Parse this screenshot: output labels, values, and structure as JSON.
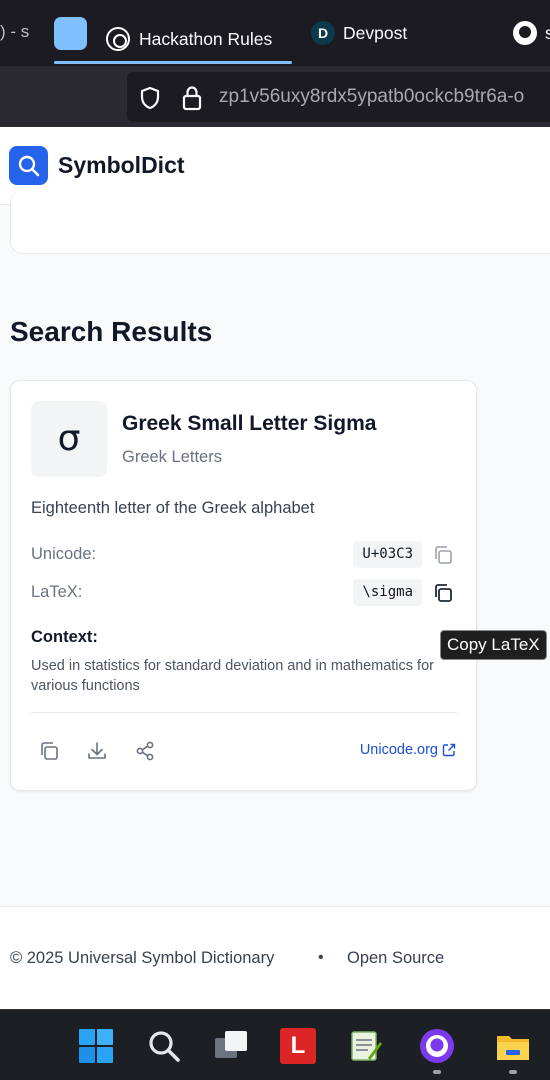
{
  "browser": {
    "tab_fragment": ") - s",
    "tabs": [
      {
        "label": "Hackathon Rules",
        "icon": "openai-icon",
        "active": true
      },
      {
        "label": "Devpost",
        "icon": "devpost-icon",
        "icon_letter": "D"
      },
      {
        "label": "s",
        "icon": "github-icon"
      }
    ],
    "url": "zp1v56uxy8rdx5ypatb0ockcb9tr6a-o"
  },
  "app": {
    "title": "SymbolDict",
    "accent": "#2563eb"
  },
  "results": {
    "heading": "Search Results",
    "card": {
      "glyph": "σ",
      "name": "Greek Small Letter Sigma",
      "category": "Greek Letters",
      "description": "Eighteenth letter of the Greek alphabet",
      "unicode_label": "Unicode:",
      "unicode_value": "U+03C3",
      "latex_label": "LaTeX:",
      "latex_value": "\\sigma",
      "context_label": "Context:",
      "context_text": "Used in statistics for standard deviation and in mathematics for various functions",
      "external_link": "Unicode.org"
    }
  },
  "tooltip": "Copy LaTeX",
  "footer": {
    "copyright": "© 2025 Universal Symbol Dictionary",
    "separator": "•",
    "link": "Open Source"
  },
  "taskbar": {
    "items": [
      "start-icon",
      "search-icon",
      "task-view-icon",
      "l-app-icon",
      "notepad-icon",
      "github-desktop-icon",
      "file-explorer-icon"
    ]
  }
}
